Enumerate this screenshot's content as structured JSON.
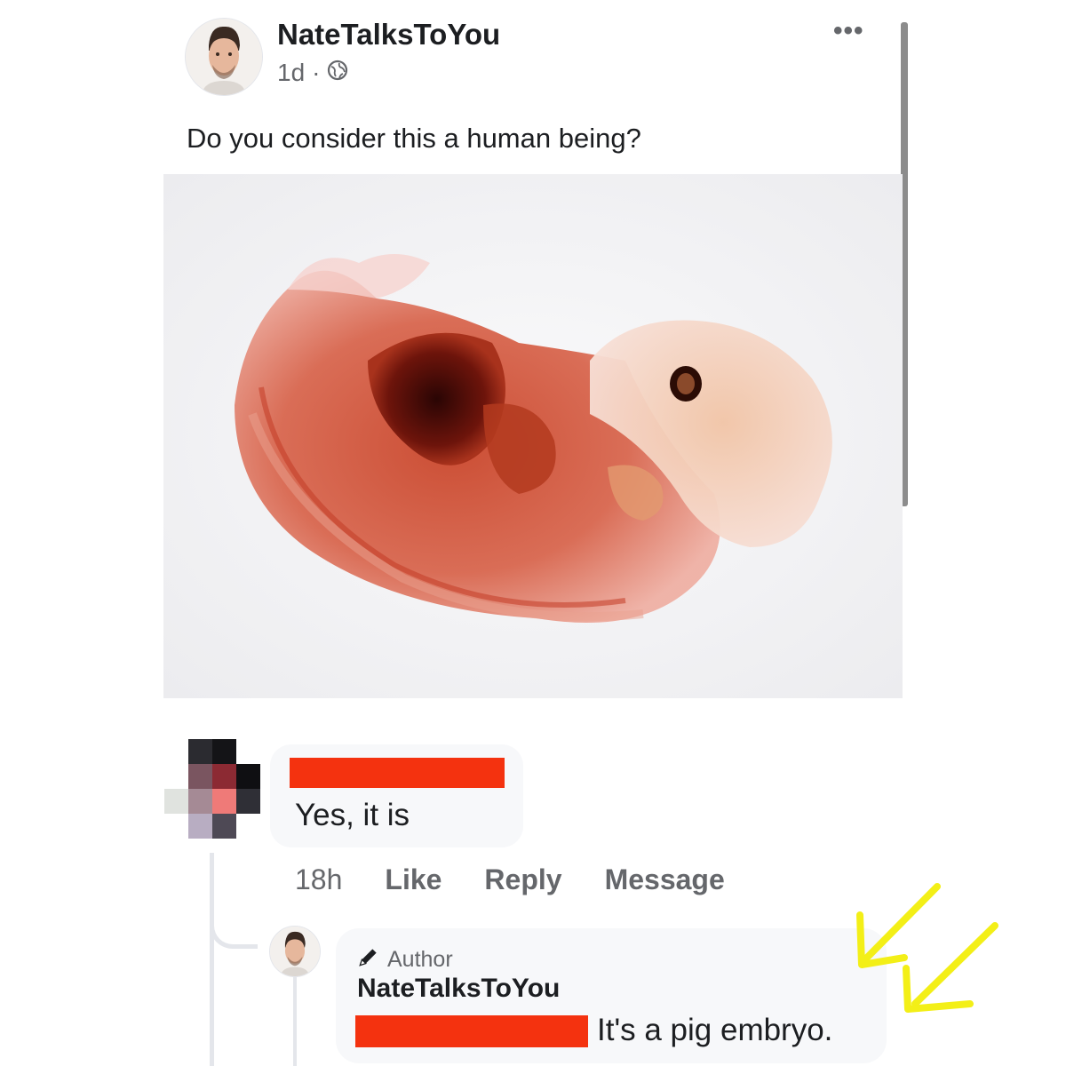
{
  "post": {
    "author": "NateTalksToYou",
    "time": "1d",
    "separator": "·",
    "text": "Do you consider this a human being?",
    "more_label": "•••"
  },
  "comment": {
    "text": "Yes, it is",
    "time": "18h",
    "actions": [
      "Like",
      "Reply",
      "Message"
    ]
  },
  "reply": {
    "badge": "Author",
    "author": "NateTalksToYou",
    "text": "It's a pig embryo."
  },
  "colors": {
    "redaction": "#f4320f",
    "annotation_arrows": "#f3ef17",
    "secondary_text": "#65676b",
    "bubble_bg": "#f7f8fa"
  },
  "icons": {
    "more": "more-dots-icon",
    "audience": "globe-icon",
    "author_badge": "pencil-icon",
    "annotation": "arrow-icon"
  }
}
